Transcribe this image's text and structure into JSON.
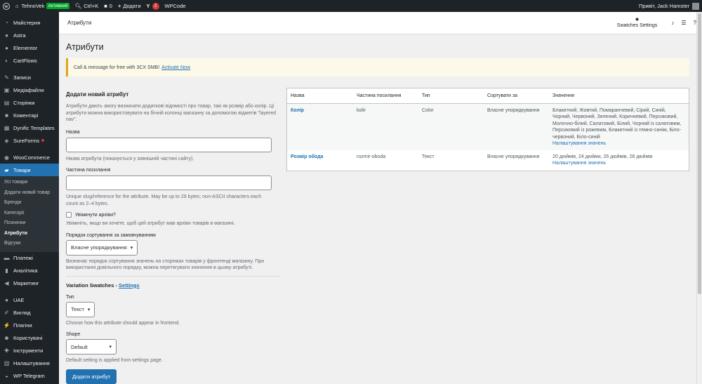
{
  "adminbar": {
    "site_name": "TehnoVek",
    "active_badge": "Активний",
    "shortcut": "Ctrl+K",
    "comments_count": "0",
    "add_new": "Додати",
    "updates_count": "2",
    "wpcode": "WPCode",
    "greeting": "Привіт, Jack Hamster"
  },
  "sidebar": {
    "items": [
      {
        "label": "Майстерня",
        "icon": "dashboard-icon"
      },
      {
        "label": "Astra",
        "icon": "astra-icon"
      },
      {
        "label": "Elementor",
        "icon": "elementor-icon"
      },
      {
        "label": "CartFlows",
        "icon": "cartflows-icon"
      },
      {
        "label": "Записи",
        "icon": "pin-icon"
      },
      {
        "label": "Медіафайли",
        "icon": "media-icon"
      },
      {
        "label": "Сторінки",
        "icon": "pages-icon"
      },
      {
        "label": "Коментарі",
        "icon": "comments-icon"
      },
      {
        "label": "Dynific Templates",
        "icon": "templates-icon"
      },
      {
        "label": "SureForms",
        "icon": "sureforms-icon"
      },
      {
        "label": "WooCommerce",
        "icon": "woocommerce-icon"
      },
      {
        "label": "Товари",
        "icon": "products-icon"
      },
      {
        "label": "Платежі",
        "icon": "payments-icon"
      },
      {
        "label": "Аналітика",
        "icon": "analytics-icon"
      },
      {
        "label": "Маркетинг",
        "icon": "marketing-icon"
      },
      {
        "label": "UAE",
        "icon": "uae-icon"
      },
      {
        "label": "Вигляд",
        "icon": "appearance-icon"
      },
      {
        "label": "Плагіни",
        "icon": "plugins-icon"
      },
      {
        "label": "Користувачі",
        "icon": "users-icon"
      },
      {
        "label": "Інструменти",
        "icon": "tools-icon"
      },
      {
        "label": "Налаштування",
        "icon": "settings-icon"
      },
      {
        "label": "WP Telegram",
        "icon": "telegram-icon"
      }
    ],
    "submenu": [
      "Усі товари",
      "Додати новий товар",
      "Бренди",
      "Категорії",
      "Позначки",
      "Атрибути",
      "Відгуки"
    ]
  },
  "topbar": {
    "title": "Атрибути",
    "swatches": "Swatches Settings"
  },
  "page": {
    "heading": "Атрибути",
    "notice_text": "Call & message for free with 3CX SMB!",
    "notice_link": "Activate Now"
  },
  "form": {
    "heading": "Додати новий атрибут",
    "intro": "Атрибути дають змогу визначати додаткові відомості про товар, такі як розмір або колір. Ці атрибути можна використовувати на бічній колонці магазину за допомогою віджетів \"layered nav\".",
    "name_label": "Назва",
    "name_desc": "Назва атрибута (показується у зовнішній частині сайту).",
    "slug_label": "Частина посилання",
    "slug_desc": "Unique slug/reference for the attribute. May be up to 29 bytes; non-ASCII characters each count as 2–4 bytes.",
    "archive_label": "Увімкнути архіви?",
    "archive_desc": "Увімкніть, якщо ви хочете, щоб цей атрибут мав архіви товарів в магазині.",
    "order_label": "Порядок сортування за замовчуванням",
    "order_value": "Власне упорядкування",
    "order_desc": "Визначає порядок сортування значень на сторінках товарів у фронтенді магазину. При використанні довільного порядку, можна перетягувати значення в цьому атрибуті.",
    "vs_title": "Variation Swatches",
    "vs_link": "Settings",
    "type_label": "Тип",
    "type_value": "Текст",
    "type_desc": "Choose how this attribute should appear in frontend.",
    "shape_label": "Shape",
    "shape_value": "Default",
    "shape_desc": "Default setting is applied from settings page.",
    "submit": "Додати атрибут"
  },
  "table": {
    "headers": [
      "Назва",
      "Частина посилання",
      "Тип",
      "Сортувати за",
      "Значення"
    ],
    "rows": [
      {
        "name": "Колір",
        "slug": "kolir",
        "type": "Color",
        "order": "Власне упорядкування",
        "values": "Блакитний, Жовтий, Помаранчевий, Сірий, Синій, Чорний, Червоний, Зелений, Коричневий, Персиковий, Молочно-білий, Салатовий, Білий, Чорний із салатовим, Персиковий із рожевим, Блакитний із темно-синім, Біло-червоний, Біло-синій",
        "configure": "Налаштування значень"
      },
      {
        "name": "Розмір обода",
        "slug": "rozmir-oboda",
        "type": "Текст",
        "order": "Власне упорядкування",
        "values": "20 дюймів, 24 дюйми, 26 дюймів, 28 дюймів",
        "configure": "Налаштування значень"
      }
    ]
  }
}
